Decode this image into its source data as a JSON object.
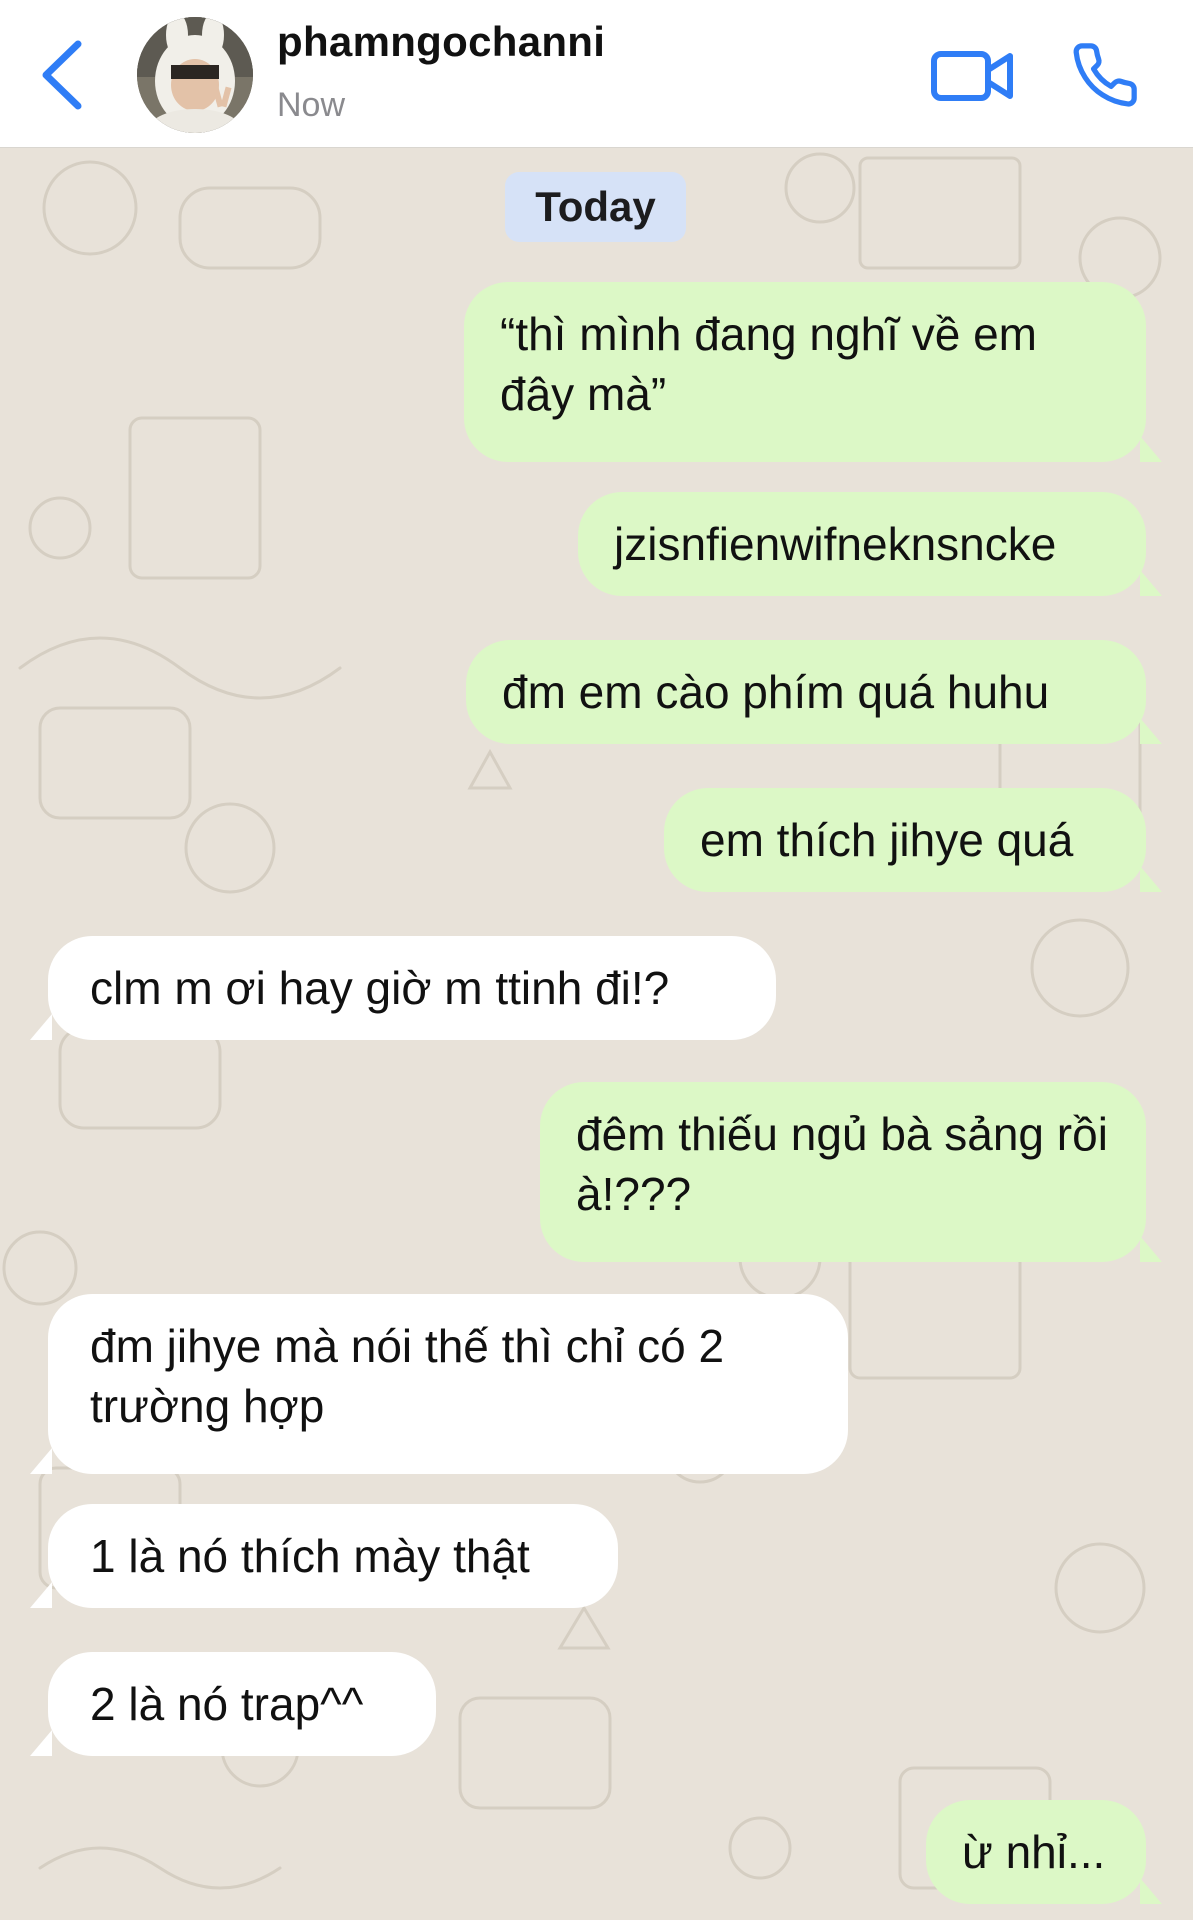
{
  "header": {
    "contact_name": "phamngochanni",
    "status": "Now",
    "back_icon": "chevron-left-icon",
    "video_icon": "video-camera-icon",
    "call_icon": "phone-icon",
    "accent_color": "#2f7df6"
  },
  "chat": {
    "date_label": "Today",
    "outgoing_bubble_color": "#dcf8c6",
    "incoming_bubble_color": "#ffffff",
    "messages": [
      {
        "direction": "out",
        "text": "“thì mình đang nghĩ về em đây mà”"
      },
      {
        "direction": "out",
        "text": "jzisnfienwifneknsncke"
      },
      {
        "direction": "out",
        "text": "đm em cào phím quá huhu"
      },
      {
        "direction": "out",
        "text": "em thích jihye quá"
      },
      {
        "direction": "in",
        "text": "clm m ơi hay giờ m ttinh đi!?"
      },
      {
        "direction": "out",
        "text": "đêm thiếu ngủ bà sảng rồi à!???"
      },
      {
        "direction": "in",
        "text": "đm jihye mà nói thế thì chỉ có 2 trường hợp"
      },
      {
        "direction": "in",
        "text": "1 là nó thích mày thật"
      },
      {
        "direction": "in",
        "text": "2 là nó trap^^"
      },
      {
        "direction": "out",
        "text": "ừ nhỉ..."
      }
    ]
  }
}
